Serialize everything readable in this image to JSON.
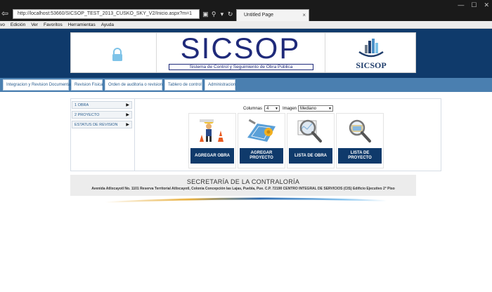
{
  "browser": {
    "url": "http://localhost:53660/SICSOP_TEST_2013_CUSKO_SKY_V2/Inicio.aspx?m=1",
    "tab_title": "Untitled Page",
    "tab_close": "×",
    "window_controls": [
      "—",
      "☐",
      "✕"
    ]
  },
  "menu": {
    "items": [
      "vo",
      "Edición",
      "Ver",
      "Favoritos",
      "Herramientas",
      "Ayuda"
    ]
  },
  "header": {
    "title": "SICSOP",
    "subtitle": "Sistema de Control y Seguimiento de Obra Pública",
    "logo_text": "SICSOP"
  },
  "nav": {
    "items": [
      "Integracion y Revision Documental",
      "Revision Fisica",
      "Orden de auditoria o revision",
      "Tablero de control",
      "Administracion"
    ]
  },
  "sidebar": {
    "items": [
      "1 OBRA",
      "2 PROYECTO",
      "ESTATUS DE REVISION"
    ],
    "arrow": "▶"
  },
  "controls": {
    "columnas_label": "Columnas",
    "columnas_value": "4",
    "imagen_label": "Imagen",
    "imagen_value": "Mediano",
    "caret": "▼"
  },
  "tiles": [
    {
      "label": "AGREGAR OBRA",
      "icon": "construction-icon"
    },
    {
      "label": "AGREGAR PROYECTO",
      "icon": "blueprint-icon"
    },
    {
      "label": "LISTA DE OBRA",
      "icon": "magnifier-icon"
    },
    {
      "label": "LISTA DE PROYECTO",
      "icon": "magnifier-folder-icon"
    }
  ],
  "footer": {
    "title": "SECRETARÍA DE LA CONTRALORÍA",
    "address": "Avenida Atlixcayotl No. 1101 Reserva Territorial Atlixcayotl, Colonia Concepción las Lajas, Puebla, Pue. C.P. 72190 CENTRO INTEGRAL DE SERVICIOS (CIS) Edificio Ejecutivo 2° Piso"
  },
  "colors": {
    "header_bg": "#0f3a6b",
    "navbar_bg": "#4a7fb0",
    "brand_text": "#1f2a7a",
    "button_bg": "#0f3a6b"
  }
}
